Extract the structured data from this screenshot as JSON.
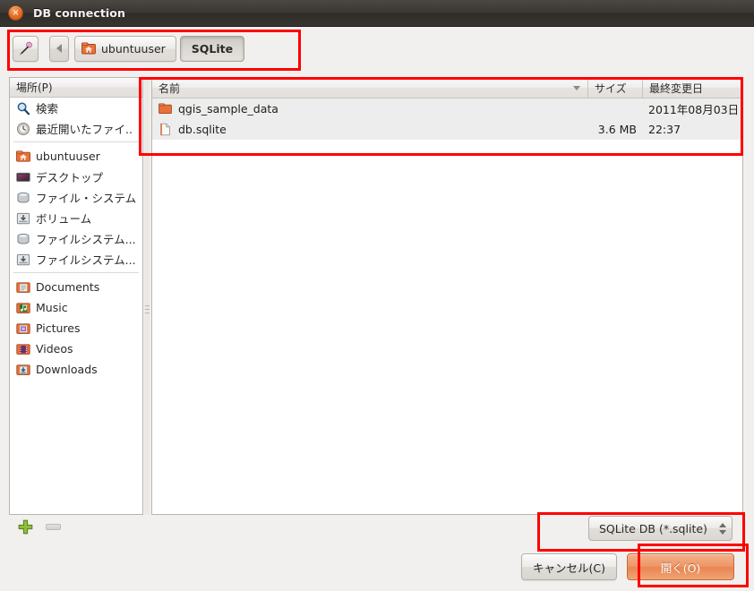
{
  "window": {
    "title": "DB connection",
    "close_icon": "close-icon",
    "close_glyph": "×"
  },
  "pathbar": {
    "edit_button": {
      "name": "location-edit-button",
      "icon": "pencil-icon"
    },
    "back_button": {
      "name": "path-back-button",
      "icon": "arrow-left-icon"
    },
    "crumbs": [
      {
        "label": "ubuntuuser",
        "icon": "home-folder-icon",
        "active": false
      },
      {
        "label": "SQLite",
        "icon": "",
        "active": true
      }
    ]
  },
  "places": {
    "header": "場所(P)",
    "groups": [
      [
        {
          "label": "検索",
          "icon": "search-icon"
        },
        {
          "label": "最近開いたファイ..",
          "icon": "recent-icon"
        }
      ],
      [
        {
          "label": "ubuntuuser",
          "icon": "home-folder-icon"
        },
        {
          "label": "デスクトップ",
          "icon": "desktop-icon"
        },
        {
          "label": "ファイル・システム",
          "icon": "filesystem-icon"
        },
        {
          "label": "ボリューム",
          "icon": "volume-icon"
        },
        {
          "label": "ファイルシステム...",
          "icon": "filesystem-icon"
        },
        {
          "label": "ファイルシステム...",
          "icon": "volume-icon"
        }
      ],
      [
        {
          "label": "Documents",
          "icon": "documents-folder-icon"
        },
        {
          "label": "Music",
          "icon": "music-folder-icon"
        },
        {
          "label": "Pictures",
          "icon": "pictures-folder-icon"
        },
        {
          "label": "Videos",
          "icon": "videos-folder-icon"
        },
        {
          "label": "Downloads",
          "icon": "downloads-folder-icon"
        }
      ]
    ],
    "add_button_icon": "plus-icon",
    "remove_button_icon": "minus-icon"
  },
  "filelist": {
    "columns": [
      {
        "label": "名前",
        "sorted": true
      },
      {
        "label": "サイズ"
      },
      {
        "label": "最終変更日"
      }
    ],
    "rows": [
      {
        "name": "qgis_sample_data",
        "size": "",
        "modified": "2011年08月03日",
        "icon": "folder-icon"
      },
      {
        "name": "db.sqlite",
        "size": "3.6 MB",
        "modified": "22:37",
        "icon": "file-icon"
      }
    ]
  },
  "footer": {
    "filter": {
      "label": "SQLite DB (*.sqlite)"
    },
    "cancel_label": "キャンセル(C)",
    "open_label": "開く(O)"
  },
  "colors": {
    "accent": "#e9854f",
    "annotation": "#ff0000",
    "titlebar": "#3a3733"
  }
}
